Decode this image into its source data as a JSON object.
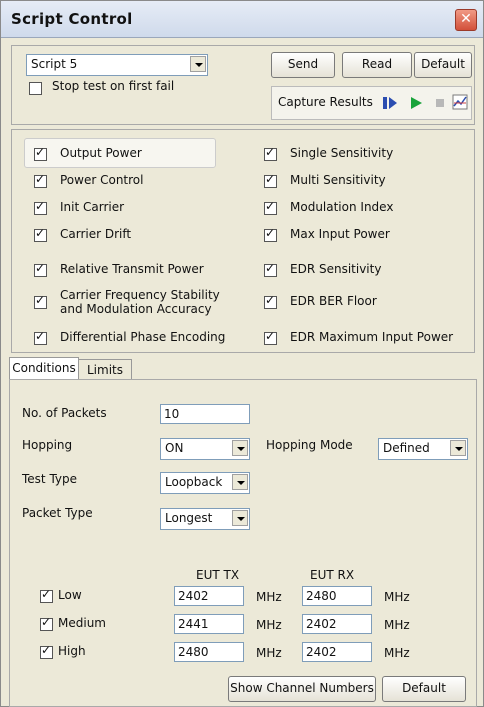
{
  "window": {
    "title": "Script Control"
  },
  "top": {
    "script_select": "Script 5",
    "stop_test_label": "Stop test on first fail",
    "send_label": "Send",
    "read_label": "Read",
    "default_label": "Default",
    "capture_label": "Capture Results"
  },
  "tests": [
    {
      "label": "Output Power",
      "checked": true
    },
    {
      "label": "Power Control",
      "checked": true
    },
    {
      "label": "Init Carrier",
      "checked": true
    },
    {
      "label": "Carrier Drift",
      "checked": true
    },
    {
      "label": "Relative Transmit Power",
      "checked": true
    },
    {
      "label": "Carrier Frequency Stability",
      "checked": true
    },
    {
      "label": "and Modulation Accuracy",
      "checked": true
    },
    {
      "label": "Differential Phase Encoding",
      "checked": true
    },
    {
      "label": "Single Sensitivity",
      "checked": true
    },
    {
      "label": "Multi Sensitivity",
      "checked": true
    },
    {
      "label": "Modulation Index",
      "checked": true
    },
    {
      "label": "Max Input Power",
      "checked": true
    },
    {
      "label": "EDR Sensitivity",
      "checked": true
    },
    {
      "label": "EDR BER Floor",
      "checked": true
    },
    {
      "label": "EDR Maximum Input Power",
      "checked": true
    }
  ],
  "tabs": [
    "Conditions",
    "Limits"
  ],
  "conditions": {
    "packets_label": "No. of Packets",
    "packets_value": "10",
    "hopping_label": "Hopping",
    "hopping_value": "ON",
    "hopping_mode_label": "Hopping Mode",
    "hopping_mode_value": "Defined",
    "test_type_label": "Test Type",
    "test_type_value": "Loopback",
    "packet_type_label": "Packet Type",
    "packet_type_value": "Longest",
    "eut_tx": "EUT TX",
    "eut_rx": "EUT RX",
    "unit": "MHz",
    "rows": [
      {
        "label": "Low",
        "tx": "2402",
        "rx": "2480"
      },
      {
        "label": "Medium",
        "tx": "2441",
        "rx": "2402"
      },
      {
        "label": "High",
        "tx": "2480",
        "rx": "2402"
      }
    ],
    "show_channel_label": "Show Channel Numbers",
    "default_label": "Default"
  }
}
